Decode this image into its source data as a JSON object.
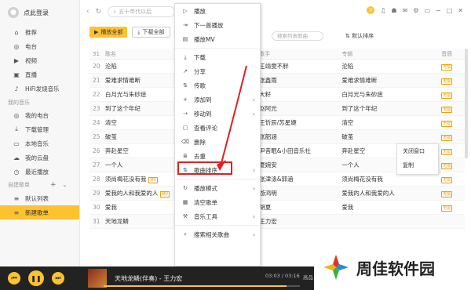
{
  "sidebar": {
    "login": "点此登录",
    "online_items": [
      {
        "label": "推荐",
        "icon": "home-icon"
      },
      {
        "label": "电台",
        "icon": "radio-icon"
      },
      {
        "label": "视频",
        "icon": "video-icon"
      },
      {
        "label": "直播",
        "icon": "live-icon"
      },
      {
        "label": "HiFi发烧音乐",
        "icon": "hifi-icon"
      }
    ],
    "my_music_title": "我的音乐",
    "my_music_items": [
      {
        "label": "我的电台",
        "icon": "radio-icon"
      },
      {
        "label": "下载管理",
        "icon": "download-icon"
      },
      {
        "label": "本地音乐",
        "icon": "computer-icon"
      },
      {
        "label": "我的云盘",
        "icon": "cloud-icon"
      },
      {
        "label": "最近播放",
        "icon": "clock-icon"
      }
    ],
    "playlist_title": "自建歌单",
    "playlist_items": [
      {
        "label": "默认列表",
        "icon": "list-icon"
      },
      {
        "label": "新建歌单",
        "icon": "list-icon"
      }
    ]
  },
  "topbar": {
    "search_placeholder": "五十年代以后"
  },
  "toolbar": {
    "play_all": "播放全部",
    "download_all": "下载全部",
    "search_placeholder": "搜索列表歌曲",
    "sort": "默认排序"
  },
  "table": {
    "headers": {
      "title": "歌名",
      "artist": "歌手",
      "album": "专辑",
      "quality": "音质"
    },
    "header_no": "31",
    "rows": [
      {
        "no": "20",
        "title": "沦陷",
        "artist": "王靖雯不胖",
        "album": "沦陷",
        "q": "无损",
        "mv": ""
      },
      {
        "no": "21",
        "title": "爱难求情难断",
        "artist": "张鑫雨",
        "album": "爱难求情难断",
        "q": "无损",
        "mv": ""
      },
      {
        "no": "22",
        "title": "白月光与朱砂痣",
        "artist": "大籽",
        "album": "白月光与朱砂痣",
        "q": "无损",
        "mv": ""
      },
      {
        "no": "23",
        "title": "到了这个年纪",
        "artist": "赵阿光",
        "album": "到了这个年纪",
        "q": "无损",
        "mv": ""
      },
      {
        "no": "24",
        "title": "清空",
        "artist": "王忻辰/苏星婕",
        "album": "清空",
        "q": "无损",
        "mv": ""
      },
      {
        "no": "25",
        "title": "破茧",
        "artist": "张韶涵",
        "album": "破茧",
        "q": "无损",
        "mv": ""
      },
      {
        "no": "26",
        "title": "奔赴星空",
        "artist": "尹昔眠&小田音乐社",
        "album": "奔赴星空",
        "q": "无损",
        "mv": ""
      },
      {
        "no": "27",
        "title": "一个人",
        "artist": "夏婉安",
        "album": "一个人",
        "q": "无损",
        "mv": ""
      },
      {
        "no": "28",
        "title": "须尚梅花没有我",
        "artist": "张津涤&郭涵",
        "album": "须尚梅花没有我",
        "q": "无损",
        "mv": "MV"
      },
      {
        "no": "29",
        "title": "爱我的人和我爱的人",
        "artist": "游鸿明",
        "album": "爱我的人和我爱的人",
        "q": "无损",
        "mv": "MV"
      },
      {
        "no": "30",
        "title": "爱我",
        "artist": "胡夏",
        "album": "爱我",
        "q": "无损",
        "mv": ""
      },
      {
        "no": "31",
        "title": "天地龙鳞",
        "artist": "王力宏",
        "album": "",
        "q": "",
        "mv": ""
      }
    ]
  },
  "context_menu": {
    "items": [
      {
        "label": "播放",
        "icon": "play-icon",
        "submenu": false
      },
      {
        "label": "下一首播放",
        "icon": "next-icon",
        "submenu": false
      },
      {
        "label": "播放MV",
        "icon": "mv-icon",
        "submenu": false
      },
      {
        "sep": true
      },
      {
        "label": "下载",
        "icon": "download-icon",
        "submenu": false
      },
      {
        "label": "分享",
        "icon": "share-icon",
        "submenu": false
      },
      {
        "label": "传歌",
        "icon": "transfer-icon",
        "submenu": false
      },
      {
        "label": "添加到",
        "icon": "plus-icon",
        "submenu": true
      },
      {
        "label": "移动到",
        "icon": "move-icon",
        "submenu": true
      },
      {
        "label": "查看评论",
        "icon": "comment-icon",
        "submenu": false
      },
      {
        "label": "删除",
        "icon": "trash-icon",
        "submenu": false
      },
      {
        "label": "去重",
        "icon": "dedupe-icon",
        "submenu": false
      },
      {
        "label": "歌曲排序",
        "icon": "sort-icon",
        "submenu": true
      },
      {
        "sep": true
      },
      {
        "label": "播放模式",
        "icon": "mode-icon",
        "submenu": true
      },
      {
        "label": "清空歌单",
        "icon": "clear-icon",
        "submenu": false
      },
      {
        "label": "音乐工具",
        "icon": "tool-icon",
        "submenu": true
      },
      {
        "sep": true
      },
      {
        "label": "搜索相关歌曲",
        "icon": "search-icon",
        "submenu": true
      }
    ]
  },
  "popup": {
    "close_window": "关闭窗口",
    "copy": "复制"
  },
  "player": {
    "now_playing": "天地龙鳞(伴奏) - 王力宏",
    "time": "03:03 / 03:16",
    "quality": "高品",
    "progress": 0.93
  },
  "watermark": {
    "text": "周佳软件园"
  }
}
